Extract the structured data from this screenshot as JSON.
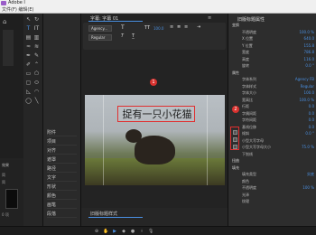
{
  "window": {
    "title": "Adobe I"
  },
  "menu": {
    "items": "文件(F)  编辑(E)"
  },
  "left_panel": {
    "timecode": "00:00:00:00",
    "header": "效果",
    "items": [
      "简",
      "简",
      "0 项"
    ]
  },
  "side_panel": {
    "items": [
      "附件",
      "项目",
      "对齐",
      "遮罩",
      "路径",
      "文字",
      "形状",
      "颜色",
      "画笔",
      "段落"
    ]
  },
  "monitor": {
    "tab_label": "字幕: 字幕 01",
    "font_family": "Agency...",
    "font_style": "Regular",
    "font_size": "100.0",
    "caption_text": "捉有一只小花猫",
    "marker_1": "1",
    "marker_2": "2",
    "bottom_label": "旧版标题样式"
  },
  "properties": {
    "header": "旧版标题属性",
    "sections": [
      {
        "label": "变换",
        "type": "section"
      },
      {
        "label": "不透明度",
        "value": "100.0 %"
      },
      {
        "label": "X 位置",
        "value": "640.0"
      },
      {
        "label": "Y 位置",
        "value": "155.8"
      },
      {
        "label": "宽度",
        "value": "786.8"
      },
      {
        "label": "高度",
        "value": "116.0"
      },
      {
        "label": "旋转",
        "value": "0.0 °"
      },
      {
        "label": "属性",
        "type": "section"
      },
      {
        "label": "字体系列",
        "value": "Agency FB"
      },
      {
        "label": "字体样式",
        "value": "Regular"
      },
      {
        "label": "字体大小",
        "value": "100.0"
      },
      {
        "label": "宽高比",
        "value": "100.0 %"
      },
      {
        "label": "行距",
        "value": "0.0"
      },
      {
        "label": "字偶间距",
        "value": "0.0"
      },
      {
        "label": "字符间距",
        "value": "0.0"
      },
      {
        "label": "基线位移",
        "value": "0.0"
      },
      {
        "label": "倾斜",
        "value": "0.0 °"
      },
      {
        "label": "小型大写字母",
        "value": ""
      },
      {
        "label": "小型大写字母大小",
        "value": "75.0 %"
      },
      {
        "label": "下划线",
        "value": ""
      },
      {
        "label": "扭曲",
        "type": "section"
      },
      {
        "label": "填充",
        "type": "section"
      },
      {
        "label": "填充类型",
        "value": "实底"
      },
      {
        "label": "颜色",
        "value": ""
      },
      {
        "label": "不透明度",
        "value": "100 %"
      },
      {
        "label": "光泽",
        "value": ""
      },
      {
        "label": "纹理",
        "value": ""
      }
    ]
  },
  "colors": {
    "accent": "#4a90e2",
    "highlight": "#e03030"
  }
}
